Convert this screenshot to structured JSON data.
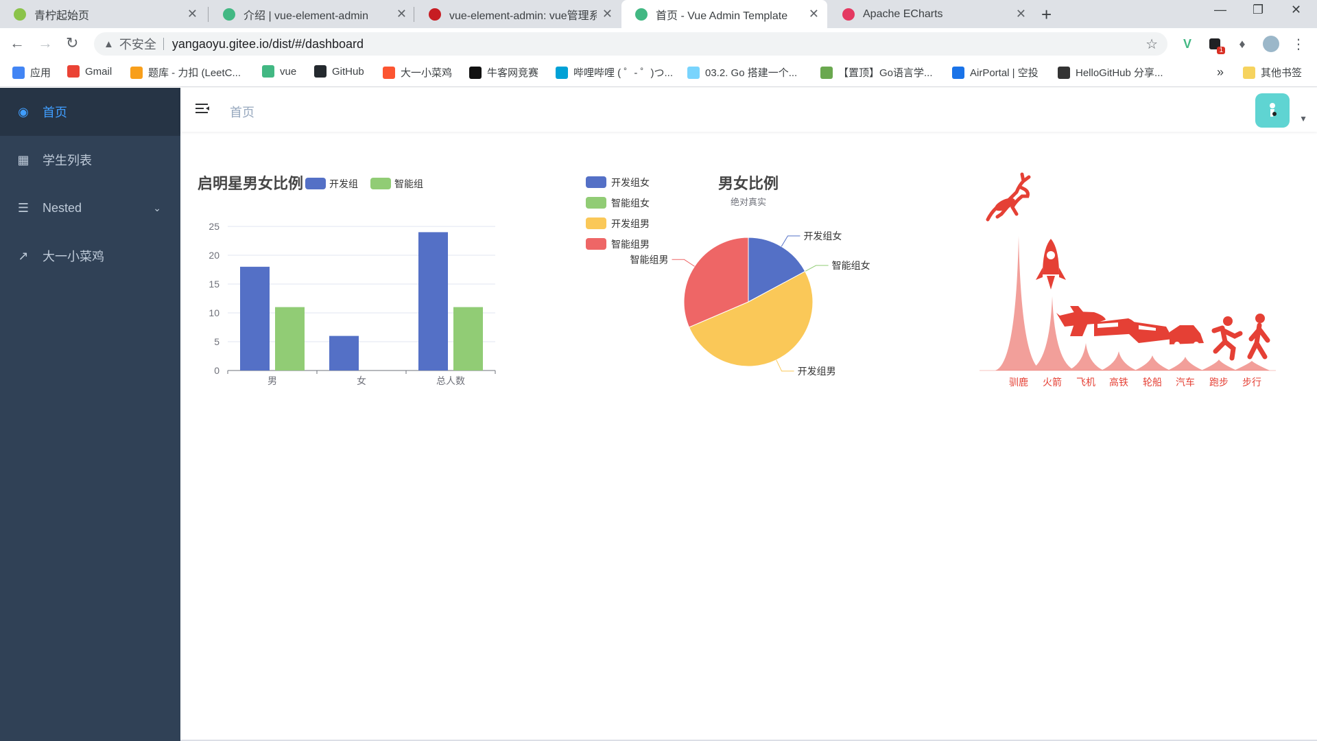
{
  "browser": {
    "tabs": [
      {
        "title": "青柠起始页",
        "favicon": "lime-icon",
        "color": "#8bc34a",
        "active": false
      },
      {
        "title": "介绍 | vue-element-admin",
        "favicon": "vue-icon",
        "color": "#42b883",
        "active": false
      },
      {
        "title": "vue-element-admin: vue管理系",
        "favicon": "gitee-icon",
        "color": "#c71d23",
        "active": false
      },
      {
        "title": "首页 - Vue Admin Template",
        "favicon": "vue-icon",
        "color": "#42b883",
        "active": true
      },
      {
        "title": "Apache ECharts",
        "favicon": "echarts-icon",
        "color": "#e43961",
        "active": false
      }
    ],
    "address": {
      "security_label": "不安全",
      "url": "yangaoyu.gitee.io/dist/#/dashboard"
    },
    "extension_badge": "1",
    "bookmarks": [
      {
        "label": "应用",
        "icon": "apps-grid-icon"
      },
      {
        "label": "Gmail",
        "icon": "google-icon"
      },
      {
        "label": "题库 - 力扣 (LeetC...",
        "icon": "leetcode-icon"
      },
      {
        "label": "vue",
        "icon": "vue-icon"
      },
      {
        "label": "GitHub",
        "icon": "github-icon"
      },
      {
        "label": "大一小菜鸡",
        "icon": "csdn-icon"
      },
      {
        "label": "牛客网竞赛",
        "icon": "nowcoder-icon"
      },
      {
        "label": "哔哩哔哩 ( ゜- ゜)つ...",
        "icon": "bilibili-icon"
      },
      {
        "label": "03.2. Go 搭建一个...",
        "icon": "gopher-icon"
      },
      {
        "label": "【置顶】Go语言学...",
        "icon": "frog-icon"
      },
      {
        "label": "AirPortal | 空投",
        "icon": "airportal-icon"
      },
      {
        "label": "HelloGitHub 分享...",
        "icon": "hellogithub-icon"
      }
    ],
    "more_bookmarks": "»",
    "other_bookmarks": "其他书签"
  },
  "sidebar": {
    "items": [
      {
        "label": "首页",
        "icon": "dashboard-icon",
        "active": true
      },
      {
        "label": "学生列表",
        "icon": "table-icon",
        "active": false
      },
      {
        "label": "Nested",
        "icon": "nested-list-icon",
        "active": false,
        "has_children": true
      },
      {
        "label": "大一小菜鸡",
        "icon": "external-link-icon",
        "active": false
      }
    ]
  },
  "header": {
    "breadcrumb": "首页"
  },
  "chart_data": [
    {
      "type": "bar",
      "title": "启明星男女比例",
      "categories": [
        "男",
        "女",
        "总人数"
      ],
      "series": [
        {
          "name": "开发组",
          "values": [
            18,
            6,
            24
          ],
          "color": "#5470c6"
        },
        {
          "name": "智能组",
          "values": [
            11,
            0,
            11
          ],
          "color": "#91cc75"
        }
      ],
      "ylim": [
        0,
        25
      ],
      "yticks": [
        0,
        5,
        10,
        15,
        20,
        25
      ],
      "legend": "top",
      "grid": true
    },
    {
      "type": "pie",
      "title": "男女比例",
      "subtitle": "绝对真实",
      "series": [
        {
          "name": "开发组女",
          "value": 6,
          "color": "#5470c6"
        },
        {
          "name": "智能组女",
          "value": 0,
          "color": "#91cc75"
        },
        {
          "name": "开发组男",
          "value": 18,
          "color": "#fac858"
        },
        {
          "name": "智能组男",
          "value": 11,
          "color": "#ee6666"
        }
      ],
      "legend": "top-left"
    },
    {
      "type": "bar",
      "categories": [
        "驯鹿",
        "火箭",
        "飞机",
        "高铁",
        "轮船",
        "汽车",
        "跑步",
        "步行"
      ],
      "color": "#e54035",
      "icons": [
        "reindeer-icon",
        "rocket-icon",
        "plane-icon",
        "train-icon",
        "ship-icon",
        "car-icon",
        "running-icon",
        "walking-icon"
      ]
    }
  ]
}
